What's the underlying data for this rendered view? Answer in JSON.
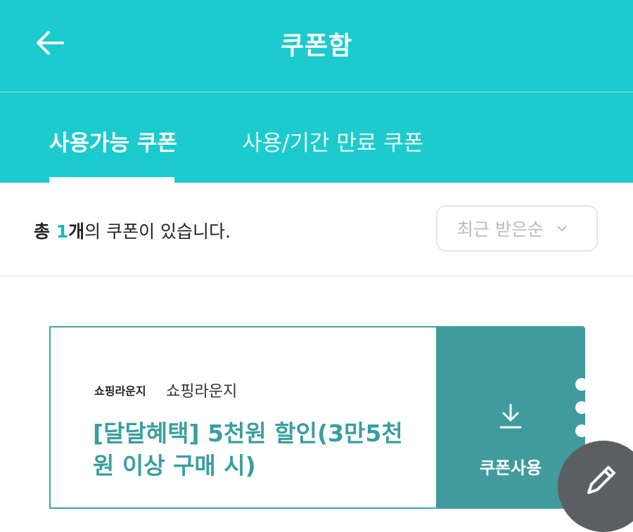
{
  "header": {
    "title": "쿠폰함",
    "back_icon": "arrow-left-icon"
  },
  "tabs": [
    {
      "label": "사용가능 쿠폰",
      "active": true
    },
    {
      "label": "사용/기간 만료 쿠폰",
      "active": false
    }
  ],
  "summary": {
    "prefix": "총 ",
    "count": "1",
    "unit": "개",
    "suffix": "의 쿠폰이 있습니다."
  },
  "sort": {
    "selected": "최근 받은순",
    "icon": "chevron-down-icon"
  },
  "coupon": {
    "store_logo": "쇼핑라운지",
    "store_name": "쇼핑라운지",
    "title": "[달달혜택] 5천원 할인(3만5천원 이상 구매 시)",
    "action_label": "쿠폰사용",
    "action_icon": "download-icon"
  },
  "fab": {
    "icon": "pencil-icon"
  },
  "colors": {
    "brand": "#1ccbcd",
    "coupon_accent": "#419b9d",
    "coupon_title": "#3a9ea1",
    "count_highlight": "#14b9bb"
  }
}
